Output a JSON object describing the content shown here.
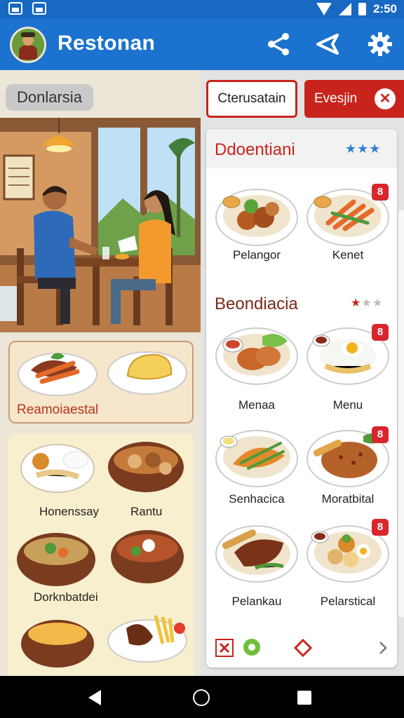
{
  "status_bar": {
    "time": "2:50"
  },
  "app": {
    "title": "Restonan"
  },
  "left": {
    "chip_label": "Donlarsia",
    "feature_card_title": "Reamoiaestal",
    "dishes": [
      "Honenssay",
      "Rantu",
      "Dorknbatdei"
    ]
  },
  "right": {
    "button_outline": "Cterusatain",
    "button_filled": "Evesjin",
    "section1": {
      "title": "Ddoentiani",
      "items": [
        "Pelangor",
        "Kenet"
      ]
    },
    "section2": {
      "title": "Beondiacia",
      "items": [
        "Menaa",
        "Menu",
        "Senhacica",
        "Moratbital",
        "Pelankau",
        "Pelarstical"
      ]
    },
    "badge_glyph": "8"
  },
  "colors": {
    "primary": "#1b72cf",
    "accent_red": "#c9241c",
    "star_blue": "#2f7fd6"
  },
  "icons": [
    "share-icon",
    "send-icon",
    "settings-icon",
    "back-icon",
    "home-icon",
    "recents-icon"
  ]
}
